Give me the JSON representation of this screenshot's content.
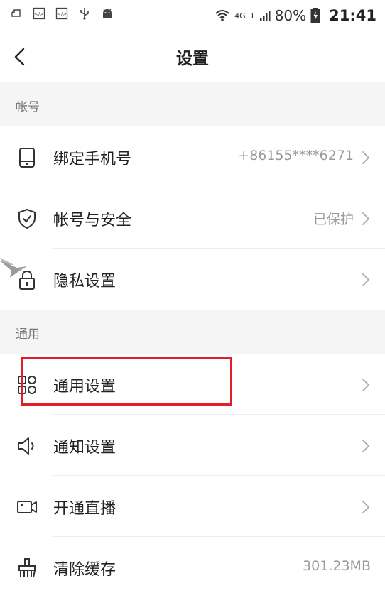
{
  "status_bar": {
    "signal_label": "4G",
    "signal_small": "1",
    "battery": "80%",
    "time": "21:41"
  },
  "header": {
    "title": "设置"
  },
  "sections": [
    {
      "title": "帐号",
      "rows": [
        {
          "label": "绑定手机号",
          "value": "+86155****6271",
          "icon": "phone-icon"
        },
        {
          "label": "帐号与安全",
          "value": "已保护",
          "icon": "shield-icon"
        },
        {
          "label": "隐私设置",
          "value": "",
          "icon": "lock-icon"
        }
      ]
    },
    {
      "title": "通用",
      "rows": [
        {
          "label": "通用设置",
          "value": "",
          "icon": "grid-icon"
        },
        {
          "label": "通知设置",
          "value": "",
          "icon": "speaker-icon"
        },
        {
          "label": "开通直播",
          "value": "",
          "icon": "video-camera-icon"
        },
        {
          "label": "清除缓存",
          "value": "301.23MB",
          "icon": "broom-icon"
        }
      ]
    }
  ],
  "colors": {
    "highlight": "#e21f26",
    "background": "#f5f5f5",
    "row_background": "#ffffff",
    "value_text": "#9a9a9a"
  }
}
